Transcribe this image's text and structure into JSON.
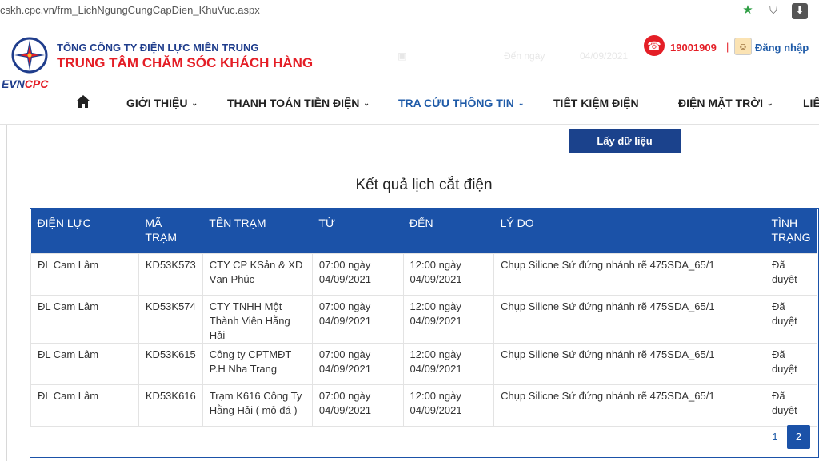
{
  "browser": {
    "url": "cskh.cpc.vn/frm_LichNgungCungCapDien_KhuVuc.aspx"
  },
  "header": {
    "logo_text_1": "EVN",
    "logo_text_2": "CPC",
    "company_line_1": "TỔNG CÔNG TY ĐIỆN LỰC MIỀN TRUNG",
    "company_line_2": "TRUNG TÂM CHĂM SÓC KHÁCH HÀNG",
    "hotline": "19001909",
    "separator": "|",
    "login_label": "Đăng nhập",
    "ghost_to_label": "Đến ngày",
    "ghost_date": "04/09/2021"
  },
  "nav": {
    "items": [
      {
        "label": "GIỚI THIỆU",
        "has_dropdown": true
      },
      {
        "label": "THANH TOÁN TIỀN ĐIỆN",
        "has_dropdown": true
      },
      {
        "label": "TRA CỨU THÔNG TIN",
        "has_dropdown": true,
        "active": true
      },
      {
        "label": "TIẾT KIỆM ĐIỆN",
        "has_dropdown": false
      },
      {
        "label": "ĐIỆN MẶT TRỜI",
        "has_dropdown": true
      },
      {
        "label": "LIÊ",
        "has_dropdown": false
      }
    ]
  },
  "form": {
    "fetch_button": "Lấy dữ liệu"
  },
  "results": {
    "title": "Kết quả lịch cắt điện",
    "columns": [
      "ĐIỆN LỰC",
      "MÃ TRẠM",
      "TÊN TRẠM",
      "TỪ",
      "ĐẾN",
      "LÝ DO",
      "TÌNH TRẠNG"
    ],
    "rows": [
      {
        "dien_luc": "ĐL Cam Lâm",
        "ma_tram": "KD53K573",
        "ten_tram": "CTY CP KSản & XD Vạn Phúc",
        "tu": "07:00 ngày 04/09/2021",
        "den": "12:00 ngày 04/09/2021",
        "ly_do": "Chụp Silicne Sứ đứng nhánh rẽ 475SDA_65/1",
        "tinh_trang": "Đã duyệt"
      },
      {
        "dien_luc": "ĐL Cam Lâm",
        "ma_tram": "KD53K574",
        "ten_tram": "CTY TNHH Một Thành Viên Hằng Hải",
        "tu": "07:00 ngày 04/09/2021",
        "den": "12:00 ngày 04/09/2021",
        "ly_do": "Chụp Silicne Sứ đứng nhánh rẽ 475SDA_65/1",
        "tinh_trang": "Đã duyệt"
      },
      {
        "dien_luc": "ĐL Cam Lâm",
        "ma_tram": "KD53K615",
        "ten_tram": "Công ty CPTMĐT P.H Nha Trang",
        "tu": "07:00 ngày 04/09/2021",
        "den": "12:00 ngày 04/09/2021",
        "ly_do": "Chụp Silicne Sứ đứng nhánh rẽ 475SDA_65/1",
        "tinh_trang": "Đã duyệt"
      },
      {
        "dien_luc": "ĐL Cam Lâm",
        "ma_tram": "KD53K616",
        "ten_tram": "Trạm K616 Công Ty Hằng Hải ( mỏ đá )",
        "tu": "07:00 ngày 04/09/2021",
        "den": "12:00 ngày 04/09/2021",
        "ly_do": "Chụp Silicne Sứ đứng nhánh rẽ 475SDA_65/1",
        "tinh_trang": "Đã duyệt"
      }
    ]
  },
  "pagination": {
    "pages": [
      "1",
      "2"
    ],
    "current": "2"
  },
  "colors": {
    "brand_blue": "#1b52a8",
    "brand_red": "#e41e26",
    "button_blue": "#1b428c"
  }
}
